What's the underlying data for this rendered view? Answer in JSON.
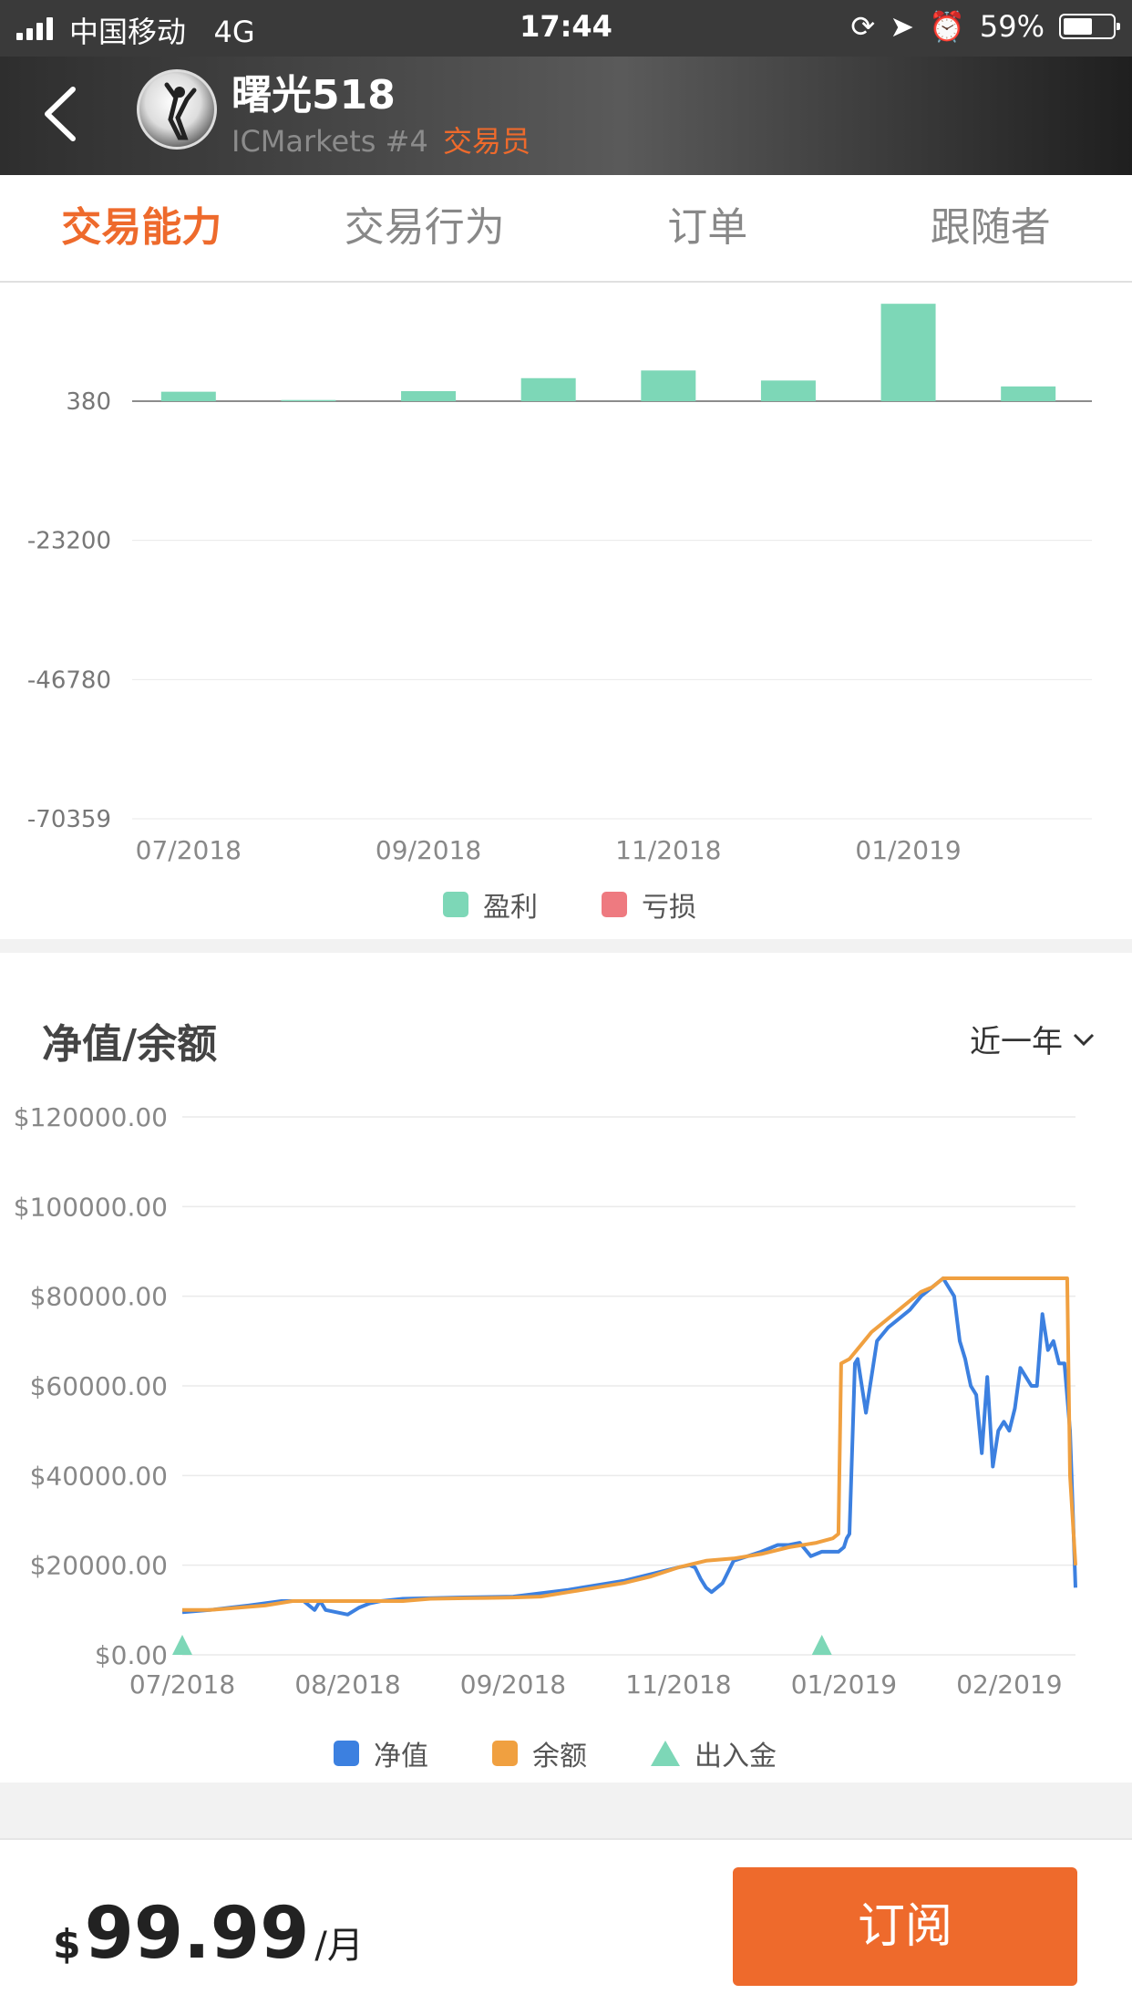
{
  "status_bar": {
    "carrier": "中国移动",
    "network": "4G",
    "time": "17:44",
    "battery": "59%",
    "battery_level": 0.59
  },
  "header": {
    "name": "曙光518",
    "broker_rank": "ICMarkets #4",
    "role": "交易员"
  },
  "tabs": [
    {
      "label": "交易能力",
      "active": true
    },
    {
      "label": "交易行为",
      "active": false
    },
    {
      "label": "订单",
      "active": false
    },
    {
      "label": "跟随者",
      "active": false
    }
  ],
  "profit_chart": {
    "legend": [
      {
        "label": "盈利",
        "color": "#7dd7b7"
      },
      {
        "label": "亏损",
        "color": "#ee7a80"
      }
    ],
    "chart_data": {
      "type": "bar",
      "y_ticks": [
        "380",
        "-23200",
        "-46780",
        "-70359"
      ],
      "y_tick_values": [
        380,
        -23200,
        -46780,
        -70359
      ],
      "x_ticks": [
        "07/2018",
        "09/2018",
        "11/2018",
        "01/2019"
      ],
      "x_tick_positions": [
        0,
        2,
        4,
        6
      ],
      "values": [
        1600,
        200,
        1700,
        3900,
        5200,
        3500,
        16500,
        2500
      ],
      "ylim": [
        -70359,
        380
      ],
      "grid": true,
      "legend_position": "bottom",
      "series": [
        {
          "name": "盈利"
        },
        {
          "name": "亏损"
        }
      ]
    }
  },
  "equity_chart": {
    "title": "净值/余额",
    "range_label": "近一年",
    "legend": [
      {
        "label": "净值",
        "color": "#3c80e0"
      },
      {
        "label": "余额",
        "color": "#f0a040"
      },
      {
        "label": "出入金",
        "color": "#7dd7b7"
      }
    ],
    "chart_data": {
      "type": "line",
      "y_ticks": [
        "$120000.00",
        "$100000.00",
        "$80000.00",
        "$60000.00",
        "$40000.00",
        "$20000.00",
        "$0.00"
      ],
      "y_tick_values": [
        120000,
        100000,
        80000,
        60000,
        40000,
        20000,
        0
      ],
      "x_ticks": [
        "07/2018",
        "08/2018",
        "09/2018",
        "11/2018",
        "01/2019",
        "02/2019"
      ],
      "x_tick_positions": [
        0,
        30,
        60,
        90,
        120,
        150
      ],
      "ylim": [
        0,
        120000
      ],
      "xlim": [
        0,
        162
      ],
      "grid": true,
      "legend_position": "bottom",
      "series": [
        {
          "name": "净值",
          "x": [
            0,
            5,
            12,
            18,
            22,
            24,
            25,
            26,
            28,
            30,
            32,
            34,
            36,
            40,
            50,
            60,
            70,
            80,
            90,
            92,
            93,
            94,
            95,
            96,
            98,
            100,
            105,
            108,
            110,
            112,
            114,
            116,
            118,
            119,
            120,
            120.5,
            121,
            122,
            122.5,
            124,
            126,
            128,
            130,
            132,
            134,
            136,
            138,
            140,
            140.5,
            141,
            142,
            142.5,
            143,
            144,
            145,
            146,
            147,
            148,
            149,
            150,
            151,
            152,
            153,
            154,
            155,
            156,
            157,
            158,
            159,
            160,
            161,
            162
          ],
          "values": [
            9500,
            10000,
            11000,
            12000,
            12000,
            10000,
            12000,
            10000,
            9500,
            9000,
            10500,
            11500,
            12000,
            12500,
            12800,
            13000,
            14500,
            16500,
            19500,
            20000,
            19500,
            17000,
            15000,
            14000,
            16000,
            21000,
            23000,
            24500,
            24500,
            25000,
            22000,
            23000,
            23000,
            23000,
            24000,
            26000,
            27000,
            65000,
            66000,
            54000,
            70000,
            73000,
            75000,
            77000,
            80000,
            82000,
            84000,
            80000,
            75000,
            70000,
            66000,
            63000,
            60000,
            58000,
            45000,
            62000,
            42000,
            50000,
            52000,
            50000,
            55000,
            64000,
            62000,
            60000,
            60000,
            76000,
            68000,
            70000,
            65000,
            65000,
            50000,
            15000
          ],
          "color": "#3c80e0"
        },
        {
          "name": "余额",
          "x": [
            0,
            5,
            10,
            15,
            20,
            30,
            35,
            40,
            45,
            50,
            55,
            60,
            65,
            70,
            75,
            80,
            85,
            90,
            95,
            100,
            105,
            110,
            115,
            118,
            119,
            119.5,
            121,
            123,
            125,
            127,
            130,
            132,
            134,
            136,
            138,
            140,
            145,
            150,
            155,
            160,
            160.5,
            161,
            162
          ],
          "values": [
            10000,
            10000,
            10500,
            11000,
            12000,
            12000,
            12000,
            12000,
            12500,
            12600,
            12700,
            12800,
            13000,
            14000,
            15000,
            16000,
            17500,
            19500,
            21000,
            21500,
            22500,
            24000,
            25000,
            26000,
            27000,
            65000,
            66000,
            69000,
            72000,
            74000,
            77000,
            79000,
            81000,
            82000,
            84000,
            84000,
            84000,
            84000,
            84000,
            84000,
            84000,
            40000,
            20000
          ],
          "color": "#f0a040"
        },
        {
          "name": "出入金",
          "type": "marker",
          "x": [
            0,
            116
          ],
          "color": "#7dd7b7"
        }
      ]
    }
  },
  "footer": {
    "currency": "$",
    "price": "99.99",
    "unit": "/月",
    "subscribe_label": "订阅"
  }
}
